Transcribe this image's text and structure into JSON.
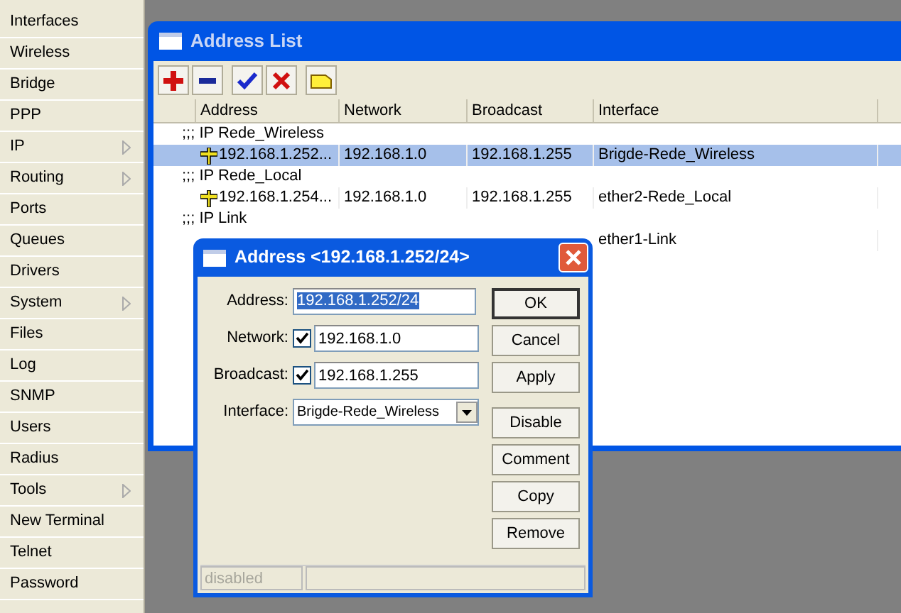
{
  "sidebar": {
    "items": [
      {
        "label": "Interfaces",
        "submenu": false
      },
      {
        "label": "Wireless",
        "submenu": false
      },
      {
        "label": "Bridge",
        "submenu": false
      },
      {
        "label": "PPP",
        "submenu": false
      },
      {
        "label": "IP",
        "submenu": true
      },
      {
        "label": "Routing",
        "submenu": true
      },
      {
        "label": "Ports",
        "submenu": false
      },
      {
        "label": "Queues",
        "submenu": false
      },
      {
        "label": "Drivers",
        "submenu": false
      },
      {
        "label": "System",
        "submenu": true
      },
      {
        "label": "Files",
        "submenu": false
      },
      {
        "label": "Log",
        "submenu": false
      },
      {
        "label": "SNMP",
        "submenu": false
      },
      {
        "label": "Users",
        "submenu": false
      },
      {
        "label": "Radius",
        "submenu": false
      },
      {
        "label": "Tools",
        "submenu": true
      },
      {
        "label": "New Terminal",
        "submenu": false
      },
      {
        "label": "Telnet",
        "submenu": false
      },
      {
        "label": "Password",
        "submenu": false
      }
    ]
  },
  "address_list": {
    "title": "Address List",
    "toolbar": [
      {
        "kind": "add"
      },
      {
        "kind": "remove"
      },
      {
        "kind": "enable"
      },
      {
        "kind": "disable"
      },
      {
        "kind": "comment"
      }
    ],
    "columns": [
      "Address",
      "Network",
      "Broadcast",
      "Interface"
    ],
    "rows": [
      {
        "kind": "comment",
        "text": ";;; IP Rede_Wireless"
      },
      {
        "kind": "address",
        "selected": true,
        "cells": [
          "192.168.1.252...",
          "192.168.1.0",
          "192.168.1.255",
          "Brigde-Rede_Wireless"
        ]
      },
      {
        "kind": "comment",
        "text": ";;; IP Rede_Local"
      },
      {
        "kind": "address",
        "selected": false,
        "cells": [
          "192.168.1.254...",
          "192.168.1.0",
          "192.168.1.255",
          "ether2-Rede_Local"
        ]
      },
      {
        "kind": "comment",
        "text": ";;; IP Link"
      },
      {
        "kind": "partial",
        "selected": false,
        "cells": [
          "ether1-Link"
        ]
      }
    ]
  },
  "dialog": {
    "title": "Address <192.168.1.252/24>",
    "fields": [
      {
        "label": "Address:",
        "value": "192.168.1.252/24",
        "kind": "text"
      },
      {
        "label": "Network:",
        "value": "192.168.1.0",
        "kind": "check",
        "checked": true
      },
      {
        "label": "Broadcast:",
        "value": "192.168.1.255",
        "kind": "check",
        "checked": true
      },
      {
        "label": "Interface:",
        "value": "Brigde-Rede_Wireless",
        "kind": "select"
      }
    ],
    "buttons": [
      {
        "label": "OK",
        "default": true
      },
      {
        "label": "Cancel",
        "default": false
      },
      {
        "label": "Apply",
        "default": false
      },
      {
        "label": "Disable",
        "default": false
      },
      {
        "label": "Comment",
        "default": false
      },
      {
        "label": "Copy",
        "default": false
      },
      {
        "label": "Remove",
        "default": false
      }
    ],
    "status": "disabled"
  }
}
